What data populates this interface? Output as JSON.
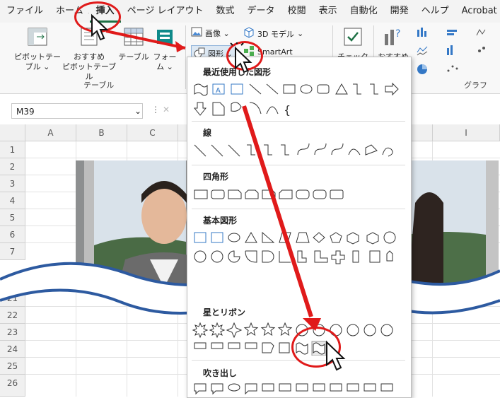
{
  "menu": {
    "tabs": [
      "ファイル",
      "ホーム",
      "挿入",
      "ページ レイアウト",
      "数式",
      "データ",
      "校閲",
      "表示",
      "自動化",
      "開発",
      "ヘルプ",
      "Acrobat"
    ],
    "active": "挿入"
  },
  "ribbon": {
    "pivot_table": "ピボットテー\nブル ⌄",
    "recommended_pivot": "おすすめ\nピボットテーブル",
    "table": "テーブル",
    "form": "フォー\nム ⌄",
    "table_group": "テーブル",
    "image": "画像 ⌄",
    "shapes": "図形 ⌄",
    "model3d": "3D モデル",
    "smartart": "SmartArt",
    "check": "チェック",
    "recommended_chart": "おすすめ",
    "graph_group": "グラフ"
  },
  "formula": {
    "namebox": "M39"
  },
  "grid": {
    "columns": [
      "A",
      "B",
      "C",
      "D",
      "E",
      "F",
      "G",
      "H",
      "I"
    ],
    "rows": [
      "1",
      "2",
      "3",
      "4",
      "5",
      "6",
      "7",
      "21",
      "22",
      "23",
      "24",
      "25",
      "26"
    ]
  },
  "shapes_panel": {
    "sections": {
      "recent": "最近使用した図形",
      "lines": "線",
      "rectangles": "四角形",
      "basic": "基本図形",
      "stars": "星とリボン",
      "callouts": "吹き出し"
    }
  },
  "colors": {
    "accent_green": "#1e7145",
    "highlight_red": "#e01a1a",
    "wave_blue": "#2d5aa0"
  }
}
